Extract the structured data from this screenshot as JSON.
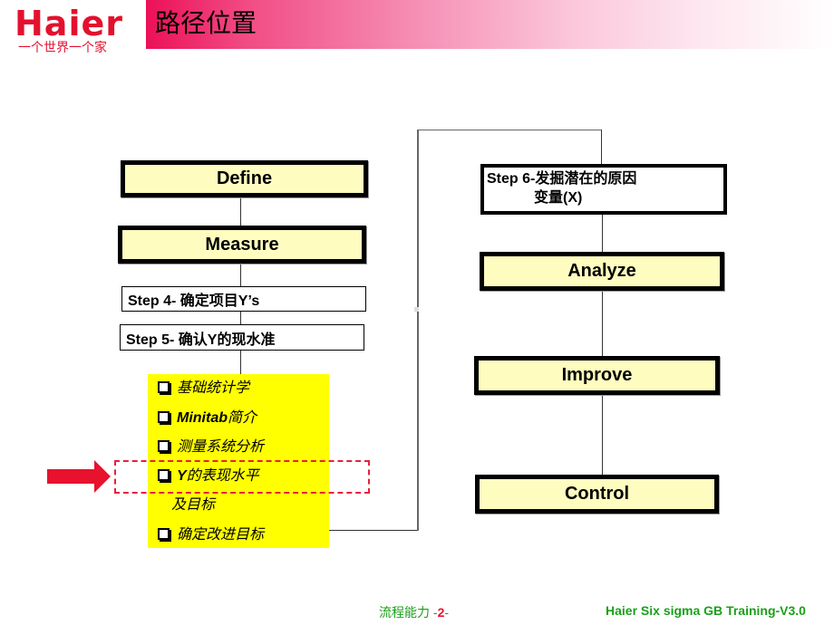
{
  "header": {
    "logo": {
      "brand": "Haier",
      "slogan": "一个世界一个家"
    },
    "title": "路径位置",
    "colors": {
      "brand_red": "#e3112e",
      "title_gradient_start": "#ec1058",
      "title_gradient_end": "#ffffff"
    }
  },
  "diagram": {
    "left_column": {
      "phases": [
        {
          "label": "Define"
        },
        {
          "label": "Measure"
        }
      ],
      "steps": [
        {
          "label": "Step 4- 确定项目Y’s"
        },
        {
          "label": "Step 5- 确认Y的现水准"
        }
      ],
      "checklist": {
        "items": [
          {
            "label": "基础统计学",
            "highlighted": false
          },
          {
            "label_bold": "Minitab",
            "label": "简介",
            "highlighted": false
          },
          {
            "label": "测量系统分析",
            "highlighted": false
          },
          {
            "label_bold": "Y",
            "label": "的表现水平",
            "continuation": "及目标",
            "highlighted": true
          },
          {
            "label": "确定改进目标",
            "highlighted": false
          }
        ],
        "background_color": "#ffff00"
      },
      "current_position_marker": "arrow-right",
      "marker_color": "#e8203b"
    },
    "right_column": {
      "step": {
        "line1": "Step 6-发掘潜在的原因",
        "line2": "变量(X)"
      },
      "phases": [
        {
          "label": "Analyze"
        },
        {
          "label": "Improve"
        },
        {
          "label": "Control"
        }
      ]
    },
    "phase_fill_color": "#fefcbf"
  },
  "footer": {
    "section": "流程能力 -",
    "page_number": "2",
    "page_suffix": "-",
    "course": "Haier Six sigma GB Training-V3.0",
    "text_color": "#1aa01a"
  }
}
